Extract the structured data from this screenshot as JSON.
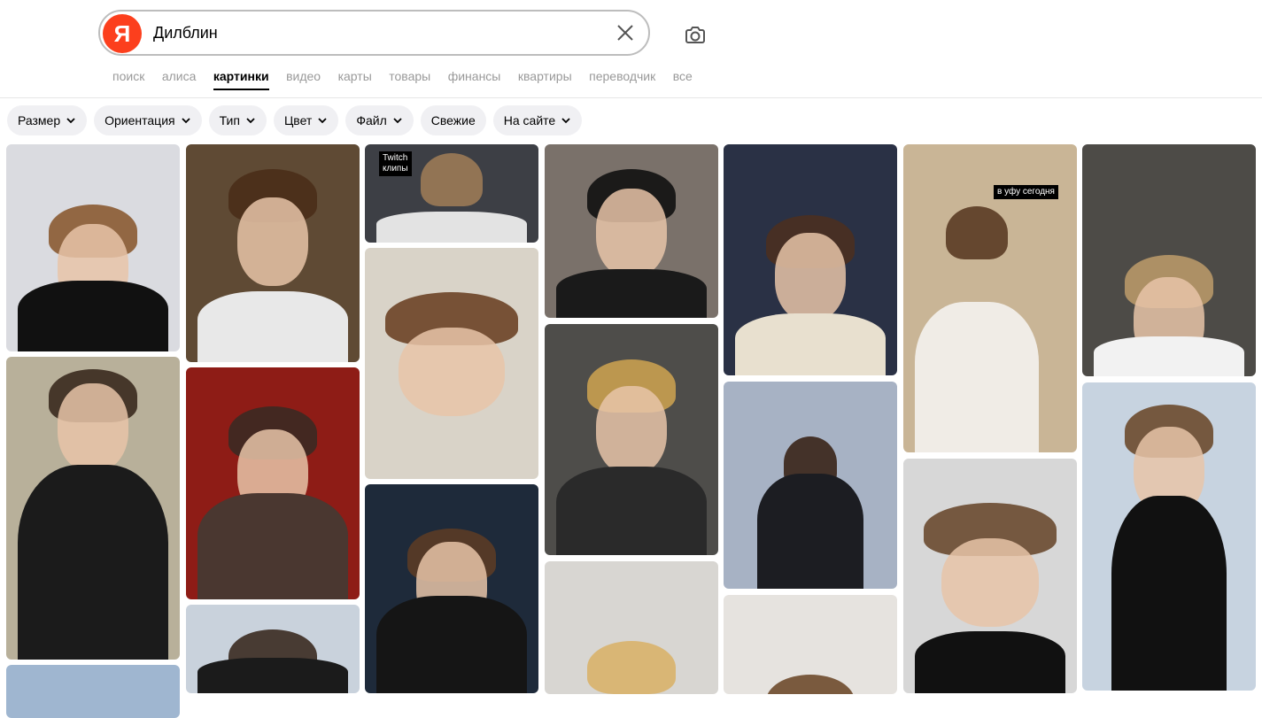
{
  "search": {
    "logo_letter": "Я",
    "query": "Дилблин"
  },
  "tabs": [
    {
      "label": "поиск"
    },
    {
      "label": "алиса"
    },
    {
      "label": "картинки",
      "active": true
    },
    {
      "label": "видео"
    },
    {
      "label": "карты"
    },
    {
      "label": "товары"
    },
    {
      "label": "финансы"
    },
    {
      "label": "квартиры"
    },
    {
      "label": "переводчик"
    },
    {
      "label": "все"
    }
  ],
  "filters": [
    {
      "label": "Размер",
      "dropdown": true
    },
    {
      "label": "Ориентация",
      "dropdown": true
    },
    {
      "label": "Тип",
      "dropdown": true
    },
    {
      "label": "Цвет",
      "dropdown": true
    },
    {
      "label": "Файл",
      "dropdown": true
    },
    {
      "label": "Свежие",
      "dropdown": false
    },
    {
      "label": "На сайте",
      "dropdown": true
    }
  ],
  "overlays": {
    "twitch_label": "Twitch\nклипы",
    "ufa_label": "в уфу сегодня"
  },
  "icons": {
    "clear": "close-icon",
    "camera": "camera-icon",
    "dropdown": "chevron-down-icon"
  },
  "colors": {
    "brand": "#fc3f1d",
    "chip_bg": "#f0f0f3",
    "tab_inactive": "#999999"
  }
}
